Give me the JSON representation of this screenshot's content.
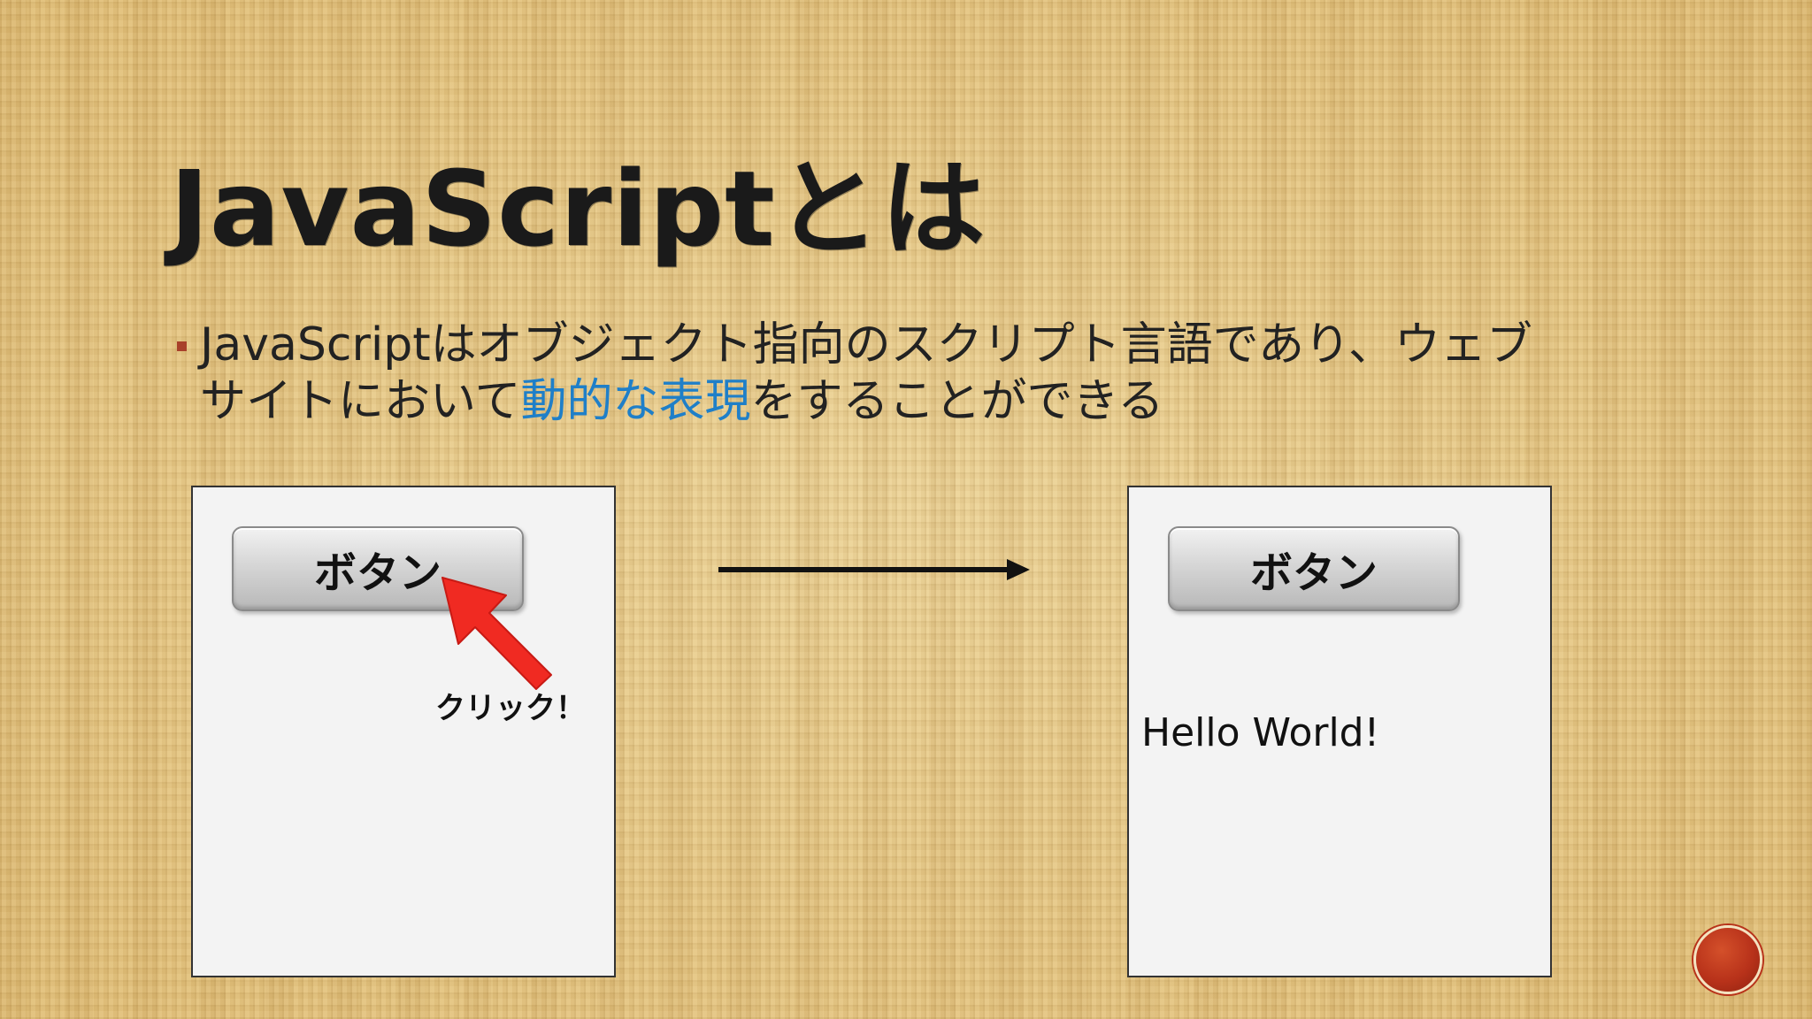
{
  "slide": {
    "title": "JavaScriptとは",
    "bullet": {
      "text_before": "JavaScriptはオブジェクト指向のスクリプト言語であり、ウェブサイトにおいて",
      "highlight": "動的な表現",
      "text_after": "をすることができる"
    }
  },
  "left_panel": {
    "button_label": "ボタン",
    "click_label": "クリック！"
  },
  "right_panel": {
    "button_label": "ボタン",
    "output_text": "Hello World!"
  },
  "colors": {
    "highlight": "#1f7fc8",
    "bullet_marker": "#a8402a",
    "click_arrow": "#f02a22",
    "nav_badge": "#b8321a"
  },
  "icons": {
    "click_arrow": "red-pointer-arrow-icon",
    "flow_arrow": "right-arrow-icon",
    "nav_badge": "red-circle-icon"
  }
}
